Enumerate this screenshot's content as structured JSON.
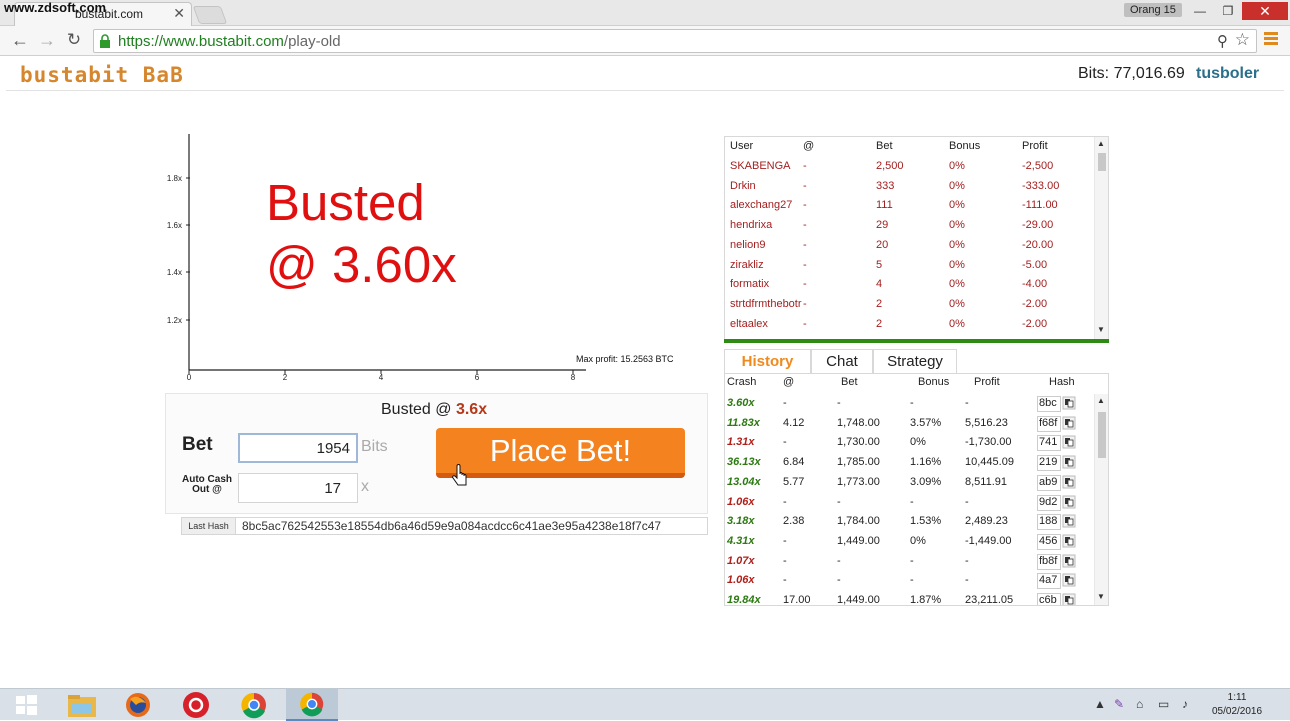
{
  "watermark": "www.zdsoft.com",
  "browser": {
    "tab_title": "bustabit.com",
    "profile_name": "Orang 15",
    "url_host": "https://www.bustabit.com",
    "url_path": "/play-old"
  },
  "header": {
    "logo": "bustabit BaB",
    "bits_label": "Bits:",
    "bits_value": "77,016.69",
    "username": "tusboler"
  },
  "chart": {
    "busted_line1": "Busted",
    "busted_line2": "@ 3.60x",
    "max_profit": "Max profit: 15.2563 BTC",
    "y_ticks": [
      "1.8x",
      "1.6x",
      "1.4x",
      "1.2x"
    ],
    "x_ticks": [
      "0",
      "2",
      "4",
      "6",
      "8"
    ]
  },
  "controls": {
    "status_prefix": "Busted @ ",
    "status_mult": "3.6x",
    "bet_label": "Bet",
    "bet_value": "1954",
    "bet_unit": "Bits",
    "autocash_label": "Auto Cash Out @",
    "cashout_value": "17",
    "cashout_unit": "x",
    "place_bet_label": "Place Bet!",
    "last_hash_label": "Last Hash",
    "last_hash_value": "8bc5ac762542553e18554db6a46d59e9a084acdcc6c41ae3e95a4238e18f7c47"
  },
  "players": {
    "headers": [
      "User",
      "@",
      "Bet",
      "Bonus",
      "Profit"
    ],
    "rows": [
      [
        "SKABENGA",
        "-",
        "2,500",
        "0%",
        "-2,500"
      ],
      [
        "Drkin",
        "-",
        "333",
        "0%",
        "-333.00"
      ],
      [
        "alexchang27",
        "-",
        "111",
        "0%",
        "-111.00"
      ],
      [
        "hendrixa",
        "-",
        "29",
        "0%",
        "-29.00"
      ],
      [
        "nelion9",
        "-",
        "20",
        "0%",
        "-20.00"
      ],
      [
        "zirakliz",
        "-",
        "5",
        "0%",
        "-5.00"
      ],
      [
        "formatix",
        "-",
        "4",
        "0%",
        "-4.00"
      ],
      [
        "strtdfrmthebotr",
        "-",
        "2",
        "0%",
        "-2.00"
      ],
      [
        "eltaalex",
        "-",
        "2",
        "0%",
        "-2.00"
      ]
    ]
  },
  "tabs": {
    "history": "History",
    "chat": "Chat",
    "strategy": "Strategy"
  },
  "history": {
    "headers": [
      "Crash",
      "@",
      "Bet",
      "Bonus",
      "Profit",
      "Hash"
    ],
    "rows": [
      {
        "crash": "3.60x",
        "win": true,
        "at": "-",
        "bet": "-",
        "bonus": "-",
        "profit": "-",
        "hash": "8bc"
      },
      {
        "crash": "11.83x",
        "win": true,
        "at": "4.12",
        "bet": "1,748.00",
        "bonus": "3.57%",
        "profit": "5,516.23",
        "hash": "f68f"
      },
      {
        "crash": "1.31x",
        "win": false,
        "at": "-",
        "bet": "1,730.00",
        "bonus": "0%",
        "profit": "-1,730.00",
        "hash": "741"
      },
      {
        "crash": "36.13x",
        "win": true,
        "at": "6.84",
        "bet": "1,785.00",
        "bonus": "1.16%",
        "profit": "10,445.09",
        "hash": "219"
      },
      {
        "crash": "13.04x",
        "win": true,
        "at": "5.77",
        "bet": "1,773.00",
        "bonus": "3.09%",
        "profit": "8,511.91",
        "hash": "ab9"
      },
      {
        "crash": "1.06x",
        "win": false,
        "at": "-",
        "bet": "-",
        "bonus": "-",
        "profit": "-",
        "hash": "9d2"
      },
      {
        "crash": "3.18x",
        "win": true,
        "at": "2.38",
        "bet": "1,784.00",
        "bonus": "1.53%",
        "profit": "2,489.23",
        "hash": "188"
      },
      {
        "crash": "4.31x",
        "win": true,
        "at": "-",
        "bet": "1,449.00",
        "bonus": "0%",
        "profit": "-1,449.00",
        "hash": "456"
      },
      {
        "crash": "1.07x",
        "win": false,
        "at": "-",
        "bet": "-",
        "bonus": "-",
        "profit": "-",
        "hash": "fb8f"
      },
      {
        "crash": "1.06x",
        "win": false,
        "at": "-",
        "bet": "-",
        "bonus": "-",
        "profit": "-",
        "hash": "4a7"
      },
      {
        "crash": "19.84x",
        "win": true,
        "at": "17.00",
        "bet": "1,449.00",
        "bonus": "1.87%",
        "profit": "23,211.05",
        "hash": "c6b"
      }
    ]
  },
  "taskbar": {
    "time": "1:11",
    "date": "05/02/2016",
    "apps": [
      "windows-start",
      "file-explorer",
      "firefox",
      "creative-cloud",
      "chrome",
      "chrome-active"
    ]
  },
  "colors": {
    "logo": "#d6862d",
    "busted_red": "#e01010",
    "place_bet": "#f4821f",
    "win_green": "#2d7a12",
    "lose_red": "#b0201a"
  }
}
